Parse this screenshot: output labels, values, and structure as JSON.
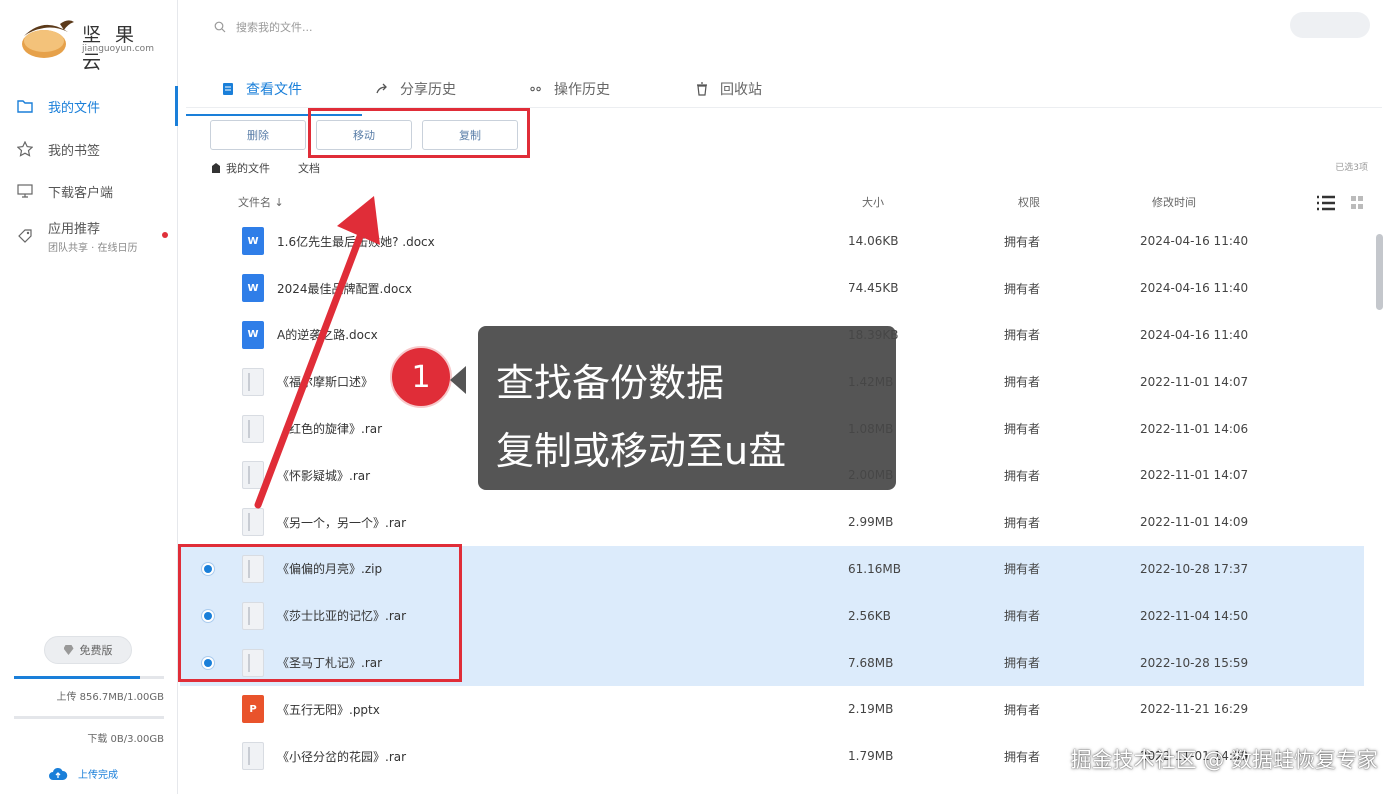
{
  "brand": {
    "name": "坚 果 云",
    "domain": "jianguoyun.com"
  },
  "search": {
    "placeholder": "搜索我的文件..."
  },
  "sidebar": {
    "items": [
      {
        "label": "我的文件",
        "icon": "folder-icon",
        "active": true
      },
      {
        "label": "我的书签",
        "icon": "star-icon"
      },
      {
        "label": "下载客户端",
        "icon": "monitor-icon"
      },
      {
        "label": "应用推荐",
        "sub": "团队共享 · 在线日历",
        "icon": "tag-icon"
      }
    ],
    "free_label": "免费版",
    "upload_quota": "上传 856.7MB/1.00GB",
    "upload_fraction": 0.84,
    "download_quota": "下载 0B/3.00GB",
    "download_fraction": 0,
    "upload_done": "上传完成"
  },
  "tabs": [
    {
      "label": "查看文件",
      "icon": "file-icon",
      "active": true
    },
    {
      "label": "分享历史",
      "icon": "share-icon"
    },
    {
      "label": "操作历史",
      "icon": "history-icon"
    },
    {
      "label": "回收站",
      "icon": "trash-icon"
    }
  ],
  "toolbar": {
    "delete": "删除",
    "move": "移动",
    "copy": "复制"
  },
  "breadcrumb": {
    "root": "我的文件",
    "current": "文档"
  },
  "loaded_text": "已选3项",
  "columns": {
    "name": "文件名 ↓",
    "size": "大小",
    "perm": "权限",
    "mtime": "修改时间"
  },
  "files": [
    {
      "name": "1.6亿先生最后击败她? .docx",
      "type": "doc",
      "size": "14.06KB",
      "perm": "拥有者",
      "mtime": "2024-04-16 11:40",
      "selected": false
    },
    {
      "name": "2024最佳品牌配置.docx",
      "type": "doc",
      "size": "74.45KB",
      "perm": "拥有者",
      "mtime": "2024-04-16 11:40",
      "selected": false
    },
    {
      "name": "A的逆袭之路.docx",
      "type": "doc",
      "size": "18.39KB",
      "perm": "拥有者",
      "mtime": "2024-04-16 11:40",
      "selected": false
    },
    {
      "name": "《福尔摩斯口述》",
      "type": "gen",
      "size": "1.42MB",
      "perm": "拥有者",
      "mtime": "2022-11-01 14:07",
      "selected": false
    },
    {
      "name": "《红色的旋律》.rar",
      "type": "gen",
      "size": "1.08MB",
      "perm": "拥有者",
      "mtime": "2022-11-01 14:06",
      "selected": false
    },
    {
      "name": "《怀影疑城》.rar",
      "type": "gen",
      "size": "2.00MB",
      "perm": "拥有者",
      "mtime": "2022-11-01 14:07",
      "selected": false
    },
    {
      "name": "《另一个，另一个》.rar",
      "type": "gen",
      "size": "2.99MB",
      "perm": "拥有者",
      "mtime": "2022-11-01 14:09",
      "selected": false
    },
    {
      "name": "《偏偏的月亮》.zip",
      "type": "gen",
      "size": "61.16MB",
      "perm": "拥有者",
      "mtime": "2022-10-28 17:37",
      "selected": true
    },
    {
      "name": "《莎士比亚的记忆》.rar",
      "type": "gen",
      "size": "2.56KB",
      "perm": "拥有者",
      "mtime": "2022-11-04 14:50",
      "selected": true
    },
    {
      "name": "《圣马丁札记》.rar",
      "type": "gen",
      "size": "7.68MB",
      "perm": "拥有者",
      "mtime": "2022-10-28 15:59",
      "selected": true
    },
    {
      "name": "《五行无阳》.pptx",
      "type": "ppt",
      "size": "2.19MB",
      "perm": "拥有者",
      "mtime": "2022-11-21 16:29",
      "selected": false
    },
    {
      "name": "《小径分岔的花园》.rar",
      "type": "gen",
      "size": "1.79MB",
      "perm": "拥有者",
      "mtime": "2022-11-01 14:09",
      "selected": false
    }
  ],
  "callout": {
    "step": "1",
    "line1": "查找备份数据",
    "line2": "复制或移动至u盘"
  },
  "watermark": "掘金技术社区 @ 数据蛙恢复专家",
  "colors": {
    "accent": "#1a7fd9",
    "highlight": "#e02d38",
    "selected_row": "#dcebfb"
  }
}
